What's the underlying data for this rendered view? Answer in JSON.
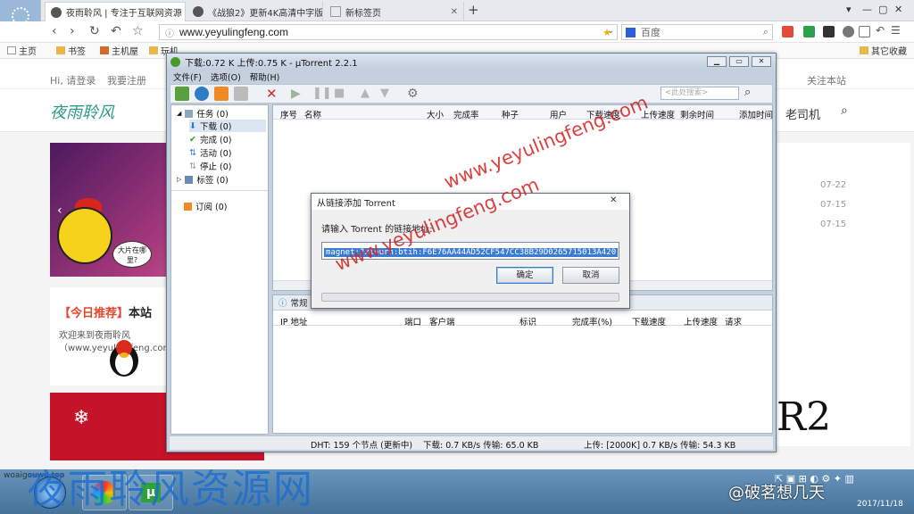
{
  "browser": {
    "tabs": [
      {
        "label": "夜雨聆风 | 专注于互联网资源",
        "active": true
      },
      {
        "label": "《战狼2》更新4K高清中字版",
        "active": false
      },
      {
        "label": "新标签页",
        "active": false
      }
    ],
    "url": "www.yeyulingfeng.com",
    "search_placeholder": "百度",
    "bookmarks": [
      "主页",
      "书签",
      "主机屋",
      "玩机",
      "其它收藏"
    ]
  },
  "site": {
    "login": "Hi, 请登录",
    "register": "我要注册",
    "follow": "关注本站",
    "logo": "夜雨聆风",
    "nav_item": "老司机",
    "rec_title_highlight": "【今日推荐】",
    "rec_title_rest": "本站",
    "rec_text": "欢迎来到夜雨聆风（www.yeyulingfeng.com）文彩...",
    "bubble": "大片在哪里?",
    "dates": [
      "07-22",
      "07-15",
      "07-15"
    ],
    "big_text": "R2"
  },
  "utorrent": {
    "title": "下载:0.72 K 上传:0.75 K - μTorrent 2.2.1",
    "menus": [
      "文件(F)",
      "选项(O)",
      "帮助(H)"
    ],
    "search_placeholder": "<此处搜索>",
    "categories": [
      {
        "label": "任务 (0)"
      },
      {
        "label": "下载 (0)"
      },
      {
        "label": "完成 (0)"
      },
      {
        "label": "活动 (0)"
      },
      {
        "label": "停止 (0)"
      },
      {
        "label": "标签 (0)"
      },
      {
        "label": "订阅 (0)"
      }
    ],
    "columns": [
      "序号",
      "名称",
      "大小",
      "完成率",
      "种子",
      "用户",
      "下载速度",
      "上传速度",
      "剩余时间",
      "添加时间"
    ],
    "detail_tab": "常规",
    "peer_columns": [
      "IP 地址",
      "端口",
      "客户端",
      "标识",
      "完成率(%)",
      "下载速度",
      "上传速度",
      "请求"
    ],
    "status": {
      "dht": "DHT: 159 个节点 (更新中)",
      "down": "下载: 0.7 KB/s 传输: 65.0 KB",
      "up": "上传: [2000K] 0.7 KB/s 传输: 54.3 KB"
    }
  },
  "dialog": {
    "title": "从链接添加 Torrent",
    "label": "请输入 Torrent 的链接地址:",
    "value": "magnet:?xt=urn:btih:F6E76AA44AD52CF547CC38B29D0265715013A420",
    "ok": "确定",
    "cancel": "取消"
  },
  "watermarks": {
    "diagonal": "www.yeyulingfeng.com",
    "site_name": "夜雨聆风资源网",
    "weibo": "@破茗想几天",
    "small_domain": "woaigouwu.top",
    "date": "2017/11/18"
  }
}
